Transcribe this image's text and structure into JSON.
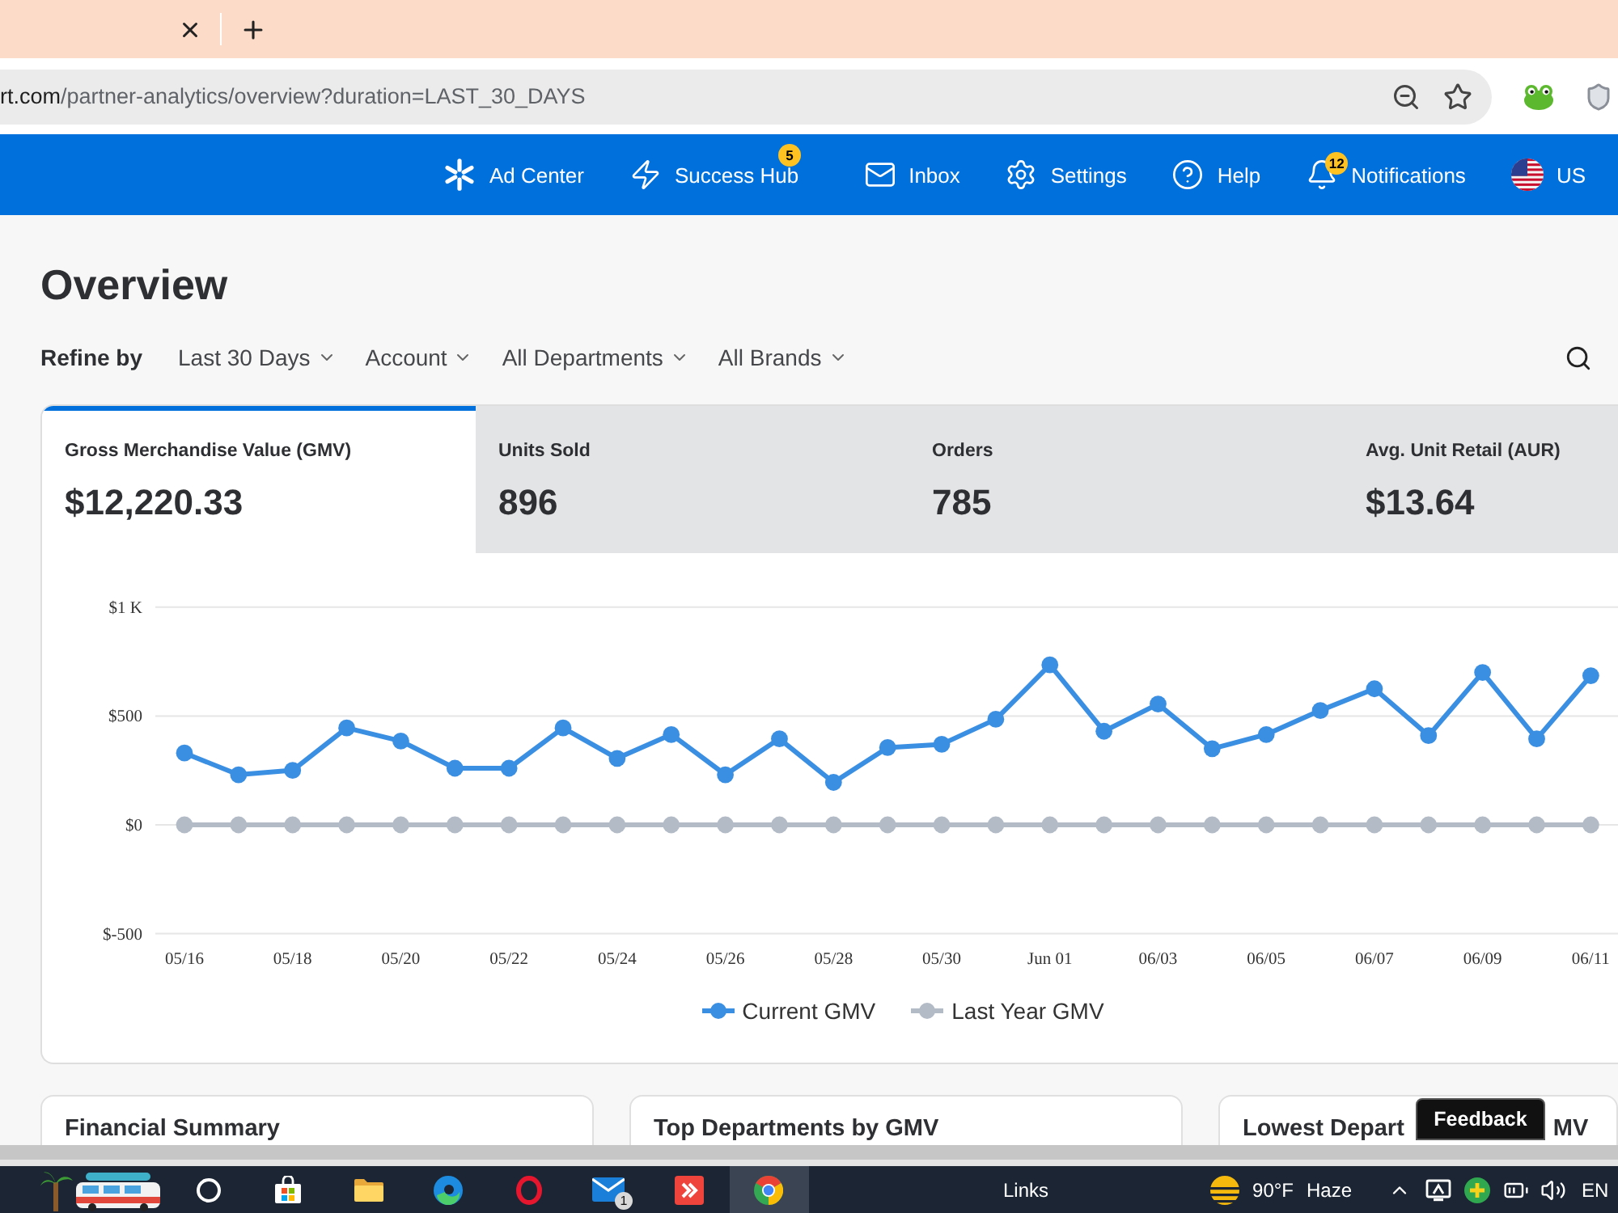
{
  "browser": {
    "url_host": "rt.com",
    "url_path": "/partner-analytics/overview?duration=LAST_30_DAYS"
  },
  "nav": {
    "items": [
      {
        "kind": "spark",
        "label": "Ad Center"
      },
      {
        "kind": "bolt",
        "label": "Success Hub",
        "badge": "5"
      },
      {
        "kind": "mail",
        "label": "Inbox"
      },
      {
        "kind": "gear",
        "label": "Settings"
      },
      {
        "kind": "help",
        "label": "Help"
      },
      {
        "kind": "bell",
        "label": "Notifications",
        "badge": "12"
      },
      {
        "kind": "flag",
        "label": "US"
      }
    ]
  },
  "page": {
    "title": "Overview",
    "refine_label": "Refine by",
    "filters": [
      "Last 30 Days",
      "Account",
      "All Departments",
      "All Brands"
    ]
  },
  "kpis": [
    {
      "label": "Gross Merchandise Value (GMV)",
      "value": "$12,220.33",
      "selected": true
    },
    {
      "label": "Units Sold",
      "value": "896",
      "selected": false
    },
    {
      "label": "Orders",
      "value": "785",
      "selected": false
    },
    {
      "label": "Avg. Unit Retail (AUR)",
      "value": "$13.64",
      "selected": false
    }
  ],
  "chart": {
    "chart_data": {
      "type": "line",
      "categories": [
        "05/16",
        null,
        "05/18",
        null,
        "05/20",
        null,
        "05/22",
        null,
        "05/24",
        null,
        "05/26",
        null,
        "05/28",
        null,
        "05/30",
        null,
        "Jun 01",
        null,
        "06/03",
        null,
        "06/05",
        null,
        "06/07",
        null,
        "06/09",
        null,
        "06/11"
      ],
      "ylim": [
        -500,
        1000
      ],
      "yticks": [
        {
          "value": -500,
          "label": "$-500"
        },
        {
          "value": 0,
          "label": "$0"
        },
        {
          "value": 500,
          "label": "$500"
        },
        {
          "value": 1000,
          "label": "$1 K"
        }
      ],
      "legend": "bottom",
      "series": [
        {
          "name": "Current GMV",
          "color": "#3b8fe3",
          "marker": "circle",
          "values": [
            330,
            230,
            250,
            445,
            385,
            260,
            260,
            445,
            305,
            415,
            230,
            395,
            195,
            355,
            370,
            485,
            735,
            430,
            555,
            350,
            415,
            525,
            625,
            410,
            700,
            395,
            685
          ]
        },
        {
          "name": "Last Year GMV",
          "color": "#b3bbc7",
          "marker": "circle",
          "values": [
            0,
            0,
            0,
            0,
            0,
            0,
            0,
            0,
            0,
            0,
            0,
            0,
            0,
            0,
            0,
            0,
            0,
            0,
            0,
            0,
            0,
            0,
            0,
            0,
            0,
            0,
            0
          ]
        }
      ]
    }
  },
  "cards": [
    {
      "title": "Financial Summary"
    },
    {
      "title": "Top Departments by GMV"
    },
    {
      "title": "Lowest Depart",
      "title_tail": "MV"
    }
  ],
  "feedback_button": "Feedback",
  "taskbar": {
    "apps": [
      {
        "kind": "ring",
        "active": false
      },
      {
        "kind": "bag",
        "active": false
      },
      {
        "kind": "folder",
        "active": false
      },
      {
        "kind": "swirl",
        "active": false
      },
      {
        "kind": "oval",
        "active": false
      },
      {
        "kind": "envelope",
        "badge": "1",
        "active": false
      },
      {
        "kind": "arrows",
        "active": false
      },
      {
        "kind": "wheel",
        "active": true
      }
    ],
    "links": "Links",
    "weather_temp": "90°F",
    "weather_condition": "Haze",
    "language": "EN"
  }
}
